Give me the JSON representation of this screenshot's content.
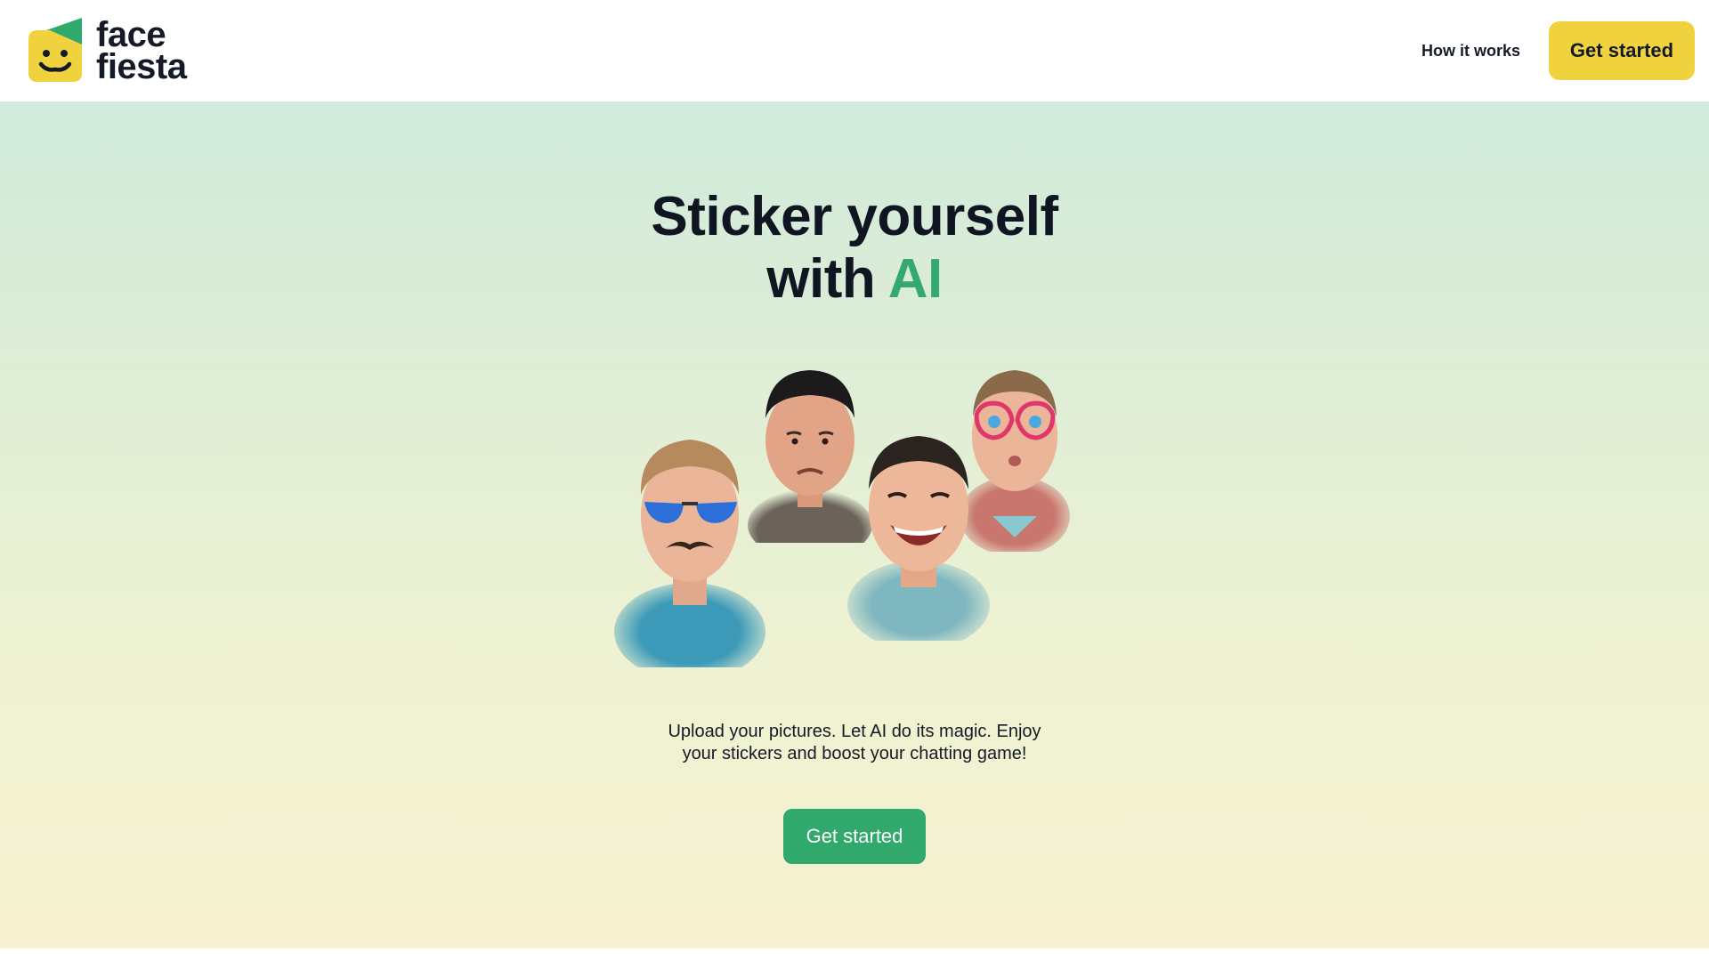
{
  "brand": {
    "line1": "face",
    "line2": "fiesta",
    "logo_icon": "smiley-face-logo-icon"
  },
  "nav": {
    "how_it_works": "How it works",
    "get_started": "Get started"
  },
  "hero": {
    "headline_line1": "Sticker yourself",
    "headline_with": "with",
    "headline_accent": "AI",
    "faces": [
      {
        "name": "face-sunglasses-mustache-sticker"
      },
      {
        "name": "face-frowning-man-sticker"
      },
      {
        "name": "face-laughing-man-sticker"
      },
      {
        "name": "face-heart-glasses-sticker"
      }
    ],
    "subtext_line1": "Upload your pictures. Let AI do its magic. Enjoy",
    "subtext_line2": "your stickers and boost your chatting game!",
    "cta": "Get started"
  },
  "colors": {
    "brand_yellow": "#f0d23f",
    "brand_green": "#31a86c",
    "accent_green": "#34a96f",
    "text_dark": "#101522"
  }
}
